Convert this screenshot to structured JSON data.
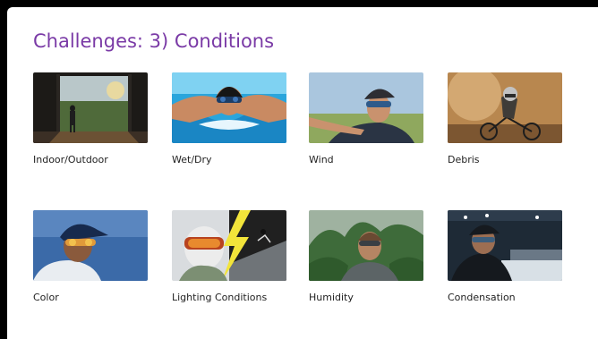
{
  "slide": {
    "title": "Challenges: 3) Conditions",
    "title_color": "#7a3aa6"
  },
  "conditions": [
    {
      "label": "Indoor/Outdoor",
      "image": "doorway-photo"
    },
    {
      "label": "Wet/Dry",
      "image": "swimmer-photo"
    },
    {
      "label": "Wind",
      "image": "cyclist-photo"
    },
    {
      "label": "Debris",
      "image": "mountain-biker-photo"
    },
    {
      "label": "Color",
      "image": "baseball-player-photo"
    },
    {
      "label": "Lighting Conditions",
      "image": "skier-lightning-photo"
    },
    {
      "label": "Humidity",
      "image": "jungle-hiker-photo"
    },
    {
      "label": "Condensation",
      "image": "hockey-player-photo"
    }
  ]
}
